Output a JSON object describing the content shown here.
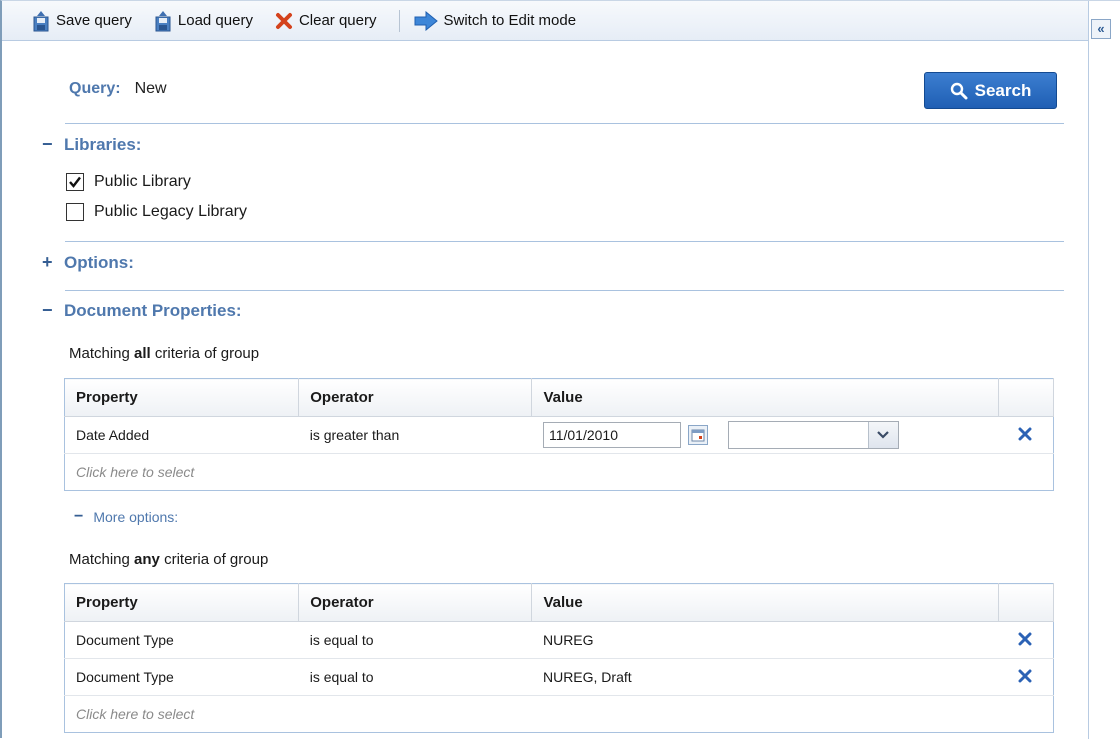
{
  "toolbar": {
    "save_label": "Save query",
    "load_label": "Load query",
    "clear_label": "Clear query",
    "switch_label": "Switch to Edit mode",
    "collapse_label": "«"
  },
  "query": {
    "label": "Query:",
    "value": "New",
    "search_label": "Search"
  },
  "libraries": {
    "toggle": "−",
    "title": "Libraries:",
    "items": [
      {
        "label": "Public Library",
        "checked": true
      },
      {
        "label": "Public Legacy Library",
        "checked": false
      }
    ]
  },
  "options": {
    "toggle": "+",
    "title": "Options:"
  },
  "doc_props": {
    "toggle": "−",
    "title": "Document Properties:",
    "group_all": {
      "caption_pre": "Matching ",
      "caption_bold": "all",
      "caption_post": " criteria of group",
      "columns": [
        "Property",
        "Operator",
        "Value"
      ],
      "rows": [
        {
          "property": "Date Added",
          "operator": "is greater than",
          "date_value": "11/01/2010",
          "combo_value": ""
        }
      ],
      "click_label": "Click here to select"
    },
    "more_options": {
      "toggle": "−",
      "label": "More options:"
    },
    "group_any": {
      "caption_pre": "Matching ",
      "caption_bold": "any",
      "caption_post": " criteria of group",
      "columns": [
        "Property",
        "Operator",
        "Value"
      ],
      "rows": [
        {
          "property": "Document Type",
          "operator": "is equal to",
          "value": "NUREG"
        },
        {
          "property": "Document Type",
          "operator": "is equal to",
          "value": "NUREG, Draft"
        }
      ],
      "click_label": "Click here to select"
    }
  },
  "colors": {
    "accent": "#4f78ad",
    "search_button": "#2a6cc3",
    "delete_icon": "#2b62b5",
    "clear_icon": "#d4421c"
  },
  "icons": {
    "save": "save-disk-icon",
    "load": "load-disk-icon",
    "clear": "red-x-icon",
    "switch": "blue-arrow-right-icon",
    "search": "magnifier-icon",
    "calendar": "calendar-icon",
    "dropdown": "chevron-down-icon",
    "delete": "delete-x-icon"
  }
}
